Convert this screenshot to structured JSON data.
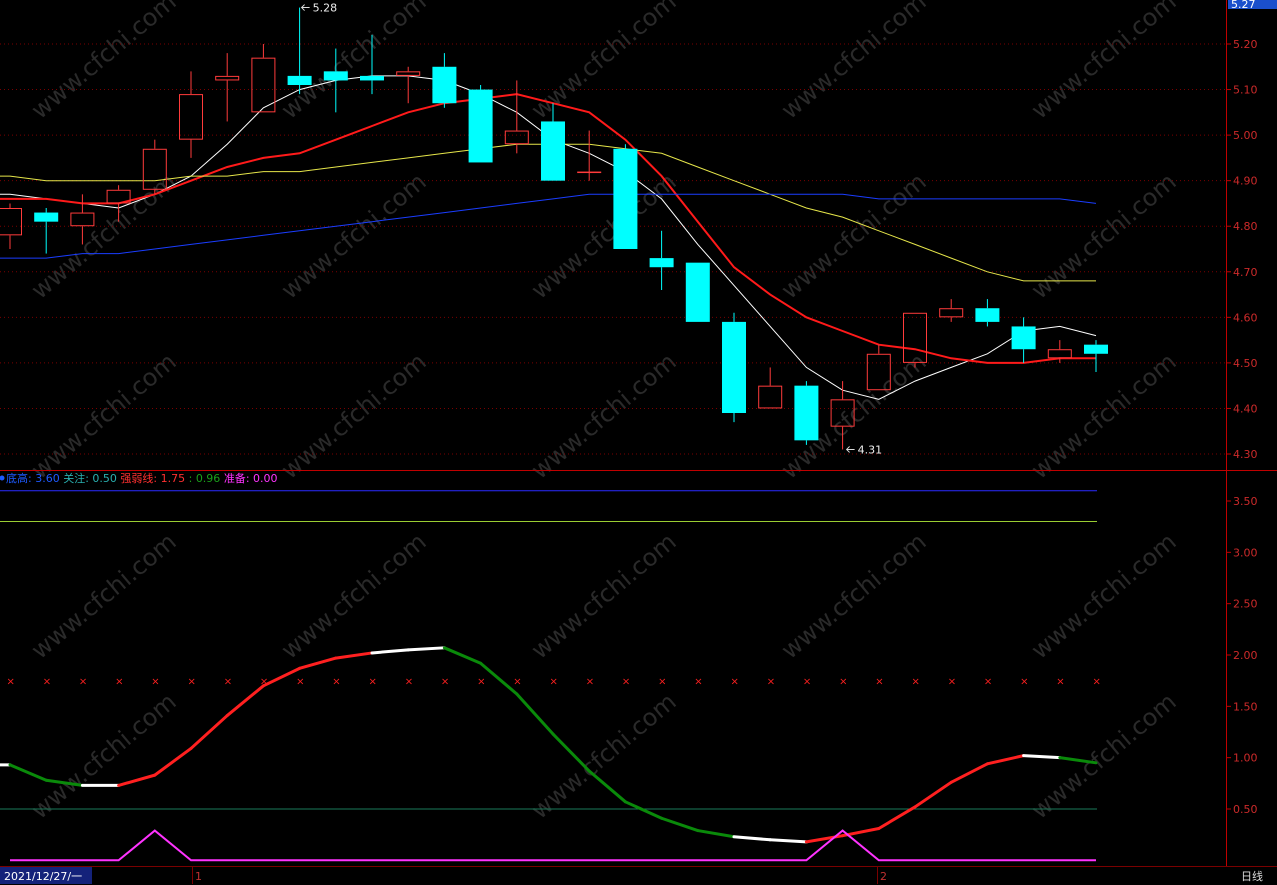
{
  "current_price_label": "5.27",
  "period_label": "日线",
  "date_label": "2021/12/27/一",
  "x_month_labels": [
    "1",
    "2"
  ],
  "watermark_text": "www.cfchi.com",
  "colors": {
    "up": "#ff3b3b",
    "down": "#00ffff",
    "ma5": "#ffffff",
    "ma10": "#ff1a1a",
    "ma20": "#e6e64a",
    "ma60": "#1a3dff",
    "grid": "#7a0000",
    "axis": "#c00000",
    "indicator_up": "#ff2020",
    "indicator_down": "#0a8a0a",
    "indicator_flat": "#ffffff",
    "prep": "#ff33ff",
    "ref_blue": "#2a2aff",
    "ref_yellow": "#9acd32",
    "ref_green": "#1a7a5a"
  },
  "indicator_legend": [
    {
      "label": "底高",
      "value": "3.60",
      "color": "#1e5aff"
    },
    {
      "label": "关注",
      "value": "0.50",
      "color": "#2ab0b0"
    },
    {
      "label": "强弱线",
      "value": "1.75",
      "color": "#ff3030"
    },
    {
      "label": "",
      "value": "0.96",
      "color": "#1aa01a"
    },
    {
      "label": "准备",
      "value": "0.00",
      "color": "#ff33ff"
    }
  ],
  "chart_data": [
    {
      "type": "candlestick",
      "ylim": [
        4.27,
        5.28
      ],
      "y_ticks": [
        "5.20",
        "5.10",
        "5.00",
        "4.90",
        "4.80",
        "4.70",
        "4.60",
        "4.50",
        "4.40",
        "4.30"
      ],
      "annotations": [
        {
          "text": "5.28",
          "value": 5.28,
          "index": 8
        },
        {
          "text": "4.31",
          "value": 4.31,
          "index": 23
        }
      ],
      "candles": [
        {
          "o": 4.78,
          "h": 4.85,
          "l": 4.75,
          "c": 4.84
        },
        {
          "o": 4.83,
          "h": 4.84,
          "l": 4.74,
          "c": 4.81
        },
        {
          "o": 4.8,
          "h": 4.87,
          "l": 4.76,
          "c": 4.83
        },
        {
          "o": 4.85,
          "h": 4.89,
          "l": 4.81,
          "c": 4.88
        },
        {
          "o": 4.88,
          "h": 4.99,
          "l": 4.87,
          "c": 4.97
        },
        {
          "o": 4.99,
          "h": 5.14,
          "l": 4.95,
          "c": 5.09
        },
        {
          "o": 5.12,
          "h": 5.18,
          "l": 5.03,
          "c": 5.13
        },
        {
          "o": 5.05,
          "h": 5.2,
          "l": 5.05,
          "c": 5.17
        },
        {
          "o": 5.13,
          "h": 5.28,
          "l": 5.09,
          "c": 5.11
        },
        {
          "o": 5.14,
          "h": 5.19,
          "l": 5.05,
          "c": 5.12
        },
        {
          "o": 5.13,
          "h": 5.22,
          "l": 5.09,
          "c": 5.12
        },
        {
          "o": 5.13,
          "h": 5.15,
          "l": 5.07,
          "c": 5.14
        },
        {
          "o": 5.15,
          "h": 5.18,
          "l": 5.06,
          "c": 5.07
        },
        {
          "o": 5.1,
          "h": 5.11,
          "l": 4.94,
          "c": 4.94
        },
        {
          "o": 4.98,
          "h": 5.12,
          "l": 4.96,
          "c": 5.01
        },
        {
          "o": 5.03,
          "h": 5.07,
          "l": 4.9,
          "c": 4.9
        },
        {
          "o": 4.92,
          "h": 5.01,
          "l": 4.9,
          "c": 4.92
        },
        {
          "o": 4.97,
          "h": 4.98,
          "l": 4.75,
          "c": 4.75
        },
        {
          "o": 4.73,
          "h": 4.79,
          "l": 4.66,
          "c": 4.71
        },
        {
          "o": 4.72,
          "h": 4.72,
          "l": 4.59,
          "c": 4.59
        },
        {
          "o": 4.59,
          "h": 4.61,
          "l": 4.37,
          "c": 4.39
        },
        {
          "o": 4.4,
          "h": 4.49,
          "l": 4.4,
          "c": 4.45
        },
        {
          "o": 4.45,
          "h": 4.46,
          "l": 4.32,
          "c": 4.33
        },
        {
          "o": 4.36,
          "h": 4.46,
          "l": 4.31,
          "c": 4.42
        },
        {
          "o": 4.44,
          "h": 4.54,
          "l": 4.44,
          "c": 4.52
        },
        {
          "o": 4.5,
          "h": 4.61,
          "l": 4.49,
          "c": 4.61
        },
        {
          "o": 4.6,
          "h": 4.64,
          "l": 4.59,
          "c": 4.62
        },
        {
          "o": 4.62,
          "h": 4.64,
          "l": 4.58,
          "c": 4.59
        },
        {
          "o": 4.58,
          "h": 4.6,
          "l": 4.5,
          "c": 4.53
        },
        {
          "o": 4.51,
          "h": 4.55,
          "l": 4.5,
          "c": 4.53
        },
        {
          "o": 4.54,
          "h": 4.55,
          "l": 4.48,
          "c": 4.52
        }
      ],
      "series": [
        {
          "key": "ma5",
          "values": [
            4.87,
            4.86,
            4.85,
            4.84,
            4.87,
            4.91,
            4.98,
            5.06,
            5.1,
            5.12,
            5.13,
            5.13,
            5.12,
            5.09,
            5.05,
            4.99,
            4.96,
            4.92,
            4.86,
            4.76,
            4.67,
            4.58,
            4.49,
            4.44,
            4.42,
            4.46,
            4.49,
            4.52,
            4.57,
            4.58,
            4.56
          ]
        },
        {
          "key": "ma10",
          "values": [
            4.86,
            4.86,
            4.85,
            4.85,
            4.87,
            4.9,
            4.93,
            4.95,
            4.96,
            4.99,
            5.02,
            5.05,
            5.07,
            5.08,
            5.09,
            5.07,
            5.05,
            4.99,
            4.91,
            4.81,
            4.71,
            4.65,
            4.6,
            4.57,
            4.54,
            4.53,
            4.51,
            4.5,
            4.5,
            4.51,
            4.51
          ]
        },
        {
          "key": "ma20",
          "values": [
            4.91,
            4.9,
            4.9,
            4.9,
            4.9,
            4.91,
            4.91,
            4.92,
            4.92,
            4.93,
            4.94,
            4.95,
            4.96,
            4.97,
            4.98,
            4.98,
            4.98,
            4.97,
            4.96,
            4.93,
            4.9,
            4.87,
            4.84,
            4.82,
            4.79,
            4.76,
            4.73,
            4.7,
            4.68,
            4.68,
            4.68
          ]
        },
        {
          "key": "ma60",
          "values": [
            4.73,
            4.73,
            4.74,
            4.74,
            4.75,
            4.76,
            4.77,
            4.78,
            4.79,
            4.8,
            4.81,
            4.82,
            4.83,
            4.84,
            4.85,
            4.86,
            4.87,
            4.87,
            4.87,
            4.87,
            4.87,
            4.87,
            4.87,
            4.87,
            4.86,
            4.86,
            4.86,
            4.86,
            4.86,
            4.86,
            4.85
          ]
        }
      ]
    },
    {
      "type": "line",
      "ylim": [
        0.0,
        3.8
      ],
      "y_ticks": [
        "3.50",
        "3.00",
        "2.50",
        "2.00",
        "1.50",
        "1.00",
        "0.50"
      ],
      "reference_lines": [
        {
          "key": "ref_blue",
          "value": 3.6
        },
        {
          "key": "ref_yellow",
          "value": 3.3
        },
        {
          "key": "ref_green",
          "value": 0.5
        }
      ],
      "marker_level": 1.75,
      "marker_count": 31,
      "strength_line": [
        0.93,
        0.78,
        0.73,
        0.73,
        0.83,
        1.09,
        1.41,
        1.7,
        1.87,
        1.97,
        2.02,
        2.05,
        2.07,
        1.92,
        1.62,
        1.23,
        0.87,
        0.57,
        0.41,
        0.29,
        0.23,
        0.2,
        0.18,
        0.24,
        0.31,
        0.52,
        0.76,
        0.94,
        1.02,
        1.0,
        0.95
      ],
      "prep_line": [
        0.0,
        0.0,
        0.0,
        0.0,
        0.29,
        0.0,
        0.0,
        0.0,
        0.0,
        0.0,
        0.0,
        0.0,
        0.0,
        0.0,
        0.0,
        0.0,
        0.0,
        0.0,
        0.0,
        0.0,
        0.0,
        0.0,
        0.0,
        0.29,
        0.0,
        0.0,
        0.0,
        0.0,
        0.0,
        0.0,
        0.0
      ]
    }
  ]
}
